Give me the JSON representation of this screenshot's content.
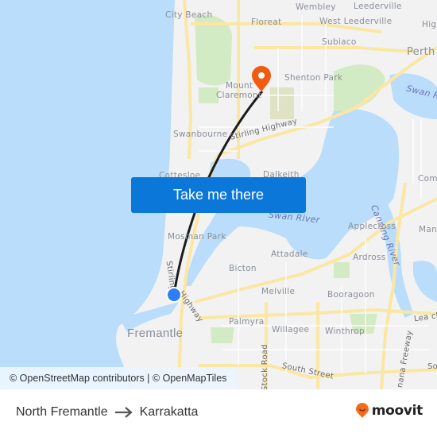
{
  "map": {
    "labels": [
      {
        "text": "City Beach",
        "kind": "suburb"
      },
      {
        "text": "Wembley",
        "kind": "suburb"
      },
      {
        "text": "Leederville",
        "kind": "suburb"
      },
      {
        "text": "West Leederville",
        "kind": "suburb"
      },
      {
        "text": "Floreat",
        "kind": "suburb"
      },
      {
        "text": "Subiaco",
        "kind": "suburb"
      },
      {
        "text": "Perth",
        "kind": "city"
      },
      {
        "text": "Hig",
        "kind": "suburb"
      },
      {
        "text": "Shenton Park",
        "kind": "suburb"
      },
      {
        "text": "Mount",
        "kind": "suburb"
      },
      {
        "text": "Claremont",
        "kind": "suburb"
      },
      {
        "text": "Swan Ri",
        "kind": "water"
      },
      {
        "text": "Swanbourne",
        "kind": "suburb"
      },
      {
        "text": "Stirling Highway",
        "kind": "road"
      },
      {
        "text": "Cottesloe",
        "kind": "suburb"
      },
      {
        "text": "Dalkeith",
        "kind": "suburb"
      },
      {
        "text": "Com",
        "kind": "suburb"
      },
      {
        "text": "Swan River",
        "kind": "water"
      },
      {
        "text": "Canning River",
        "kind": "water"
      },
      {
        "text": "Applecross",
        "kind": "suburb"
      },
      {
        "text": "Man",
        "kind": "suburb"
      },
      {
        "text": "Mosman Park",
        "kind": "suburb"
      },
      {
        "text": "Attadale",
        "kind": "suburb"
      },
      {
        "text": "Ardross",
        "kind": "suburb"
      },
      {
        "text": "Bicton",
        "kind": "suburb"
      },
      {
        "text": "Stirling",
        "kind": "road"
      },
      {
        "text": "Highway",
        "kind": "road"
      },
      {
        "text": "Melville",
        "kind": "suburb"
      },
      {
        "text": "Booragoon",
        "kind": "suburb"
      },
      {
        "text": "Palmyra",
        "kind": "suburb"
      },
      {
        "text": "Lea ch",
        "kind": "road"
      },
      {
        "text": "Fremantle",
        "kind": "city"
      },
      {
        "text": "Willagee",
        "kind": "suburb"
      },
      {
        "text": "Winthrop",
        "kind": "suburb"
      },
      {
        "text": "Stock Road",
        "kind": "road"
      },
      {
        "text": "South Street",
        "kind": "road"
      },
      {
        "text": "nana Freeway",
        "kind": "road"
      },
      {
        "text": "So",
        "kind": "road"
      }
    ],
    "origin_marker": "North Fremantle",
    "destination_marker": "Karrakatta",
    "colors": {
      "water": "#b9ddfb",
      "land": "#f2f2f2",
      "park": "#d3ebc4",
      "road": "#fbe7a3",
      "route": "#1c1c1c",
      "origin": "#2f7df6",
      "destination": "#f25a0f"
    },
    "attribution": "© OpenStreetMap contributors | © OpenMapTiles"
  },
  "cta": {
    "label": "Take me there",
    "color": "#0b78d9"
  },
  "footer": {
    "origin": "North Fremantle",
    "destination": "Karrakatta",
    "arrow_icon": "arrow-right-icon",
    "brand": "moovit",
    "brand_color": "#f26b1d"
  }
}
